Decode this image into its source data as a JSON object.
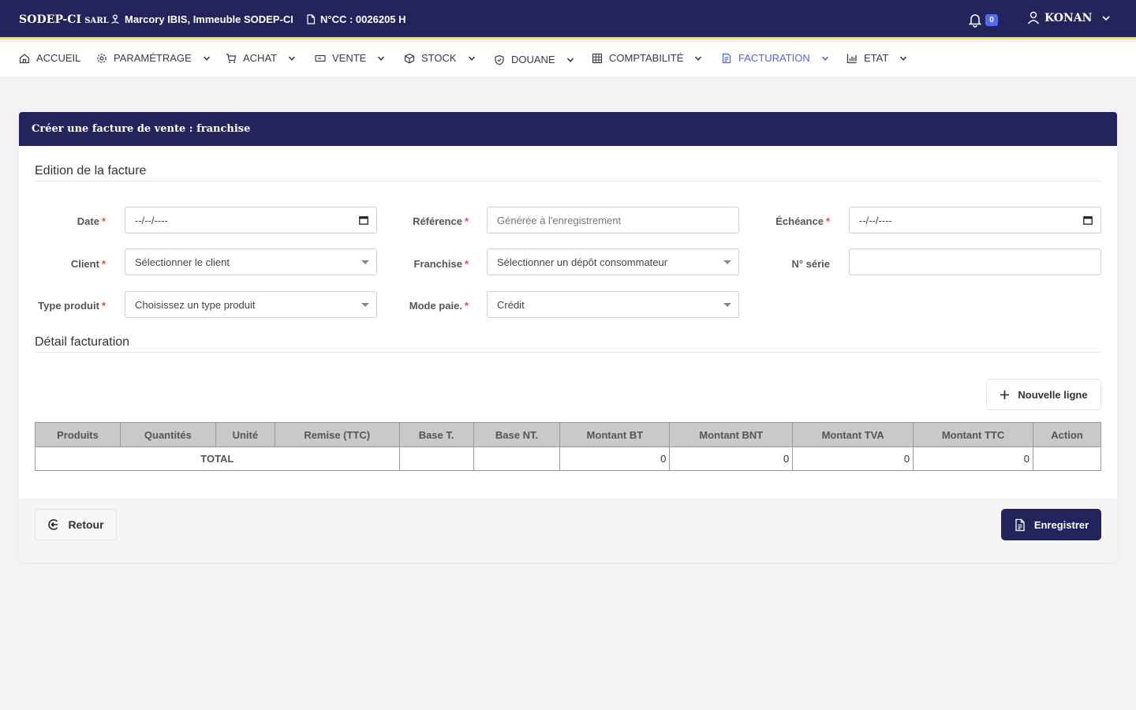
{
  "topbar": {
    "brand": "SODEP-CI",
    "brand_suffix": "SARL",
    "address": "Marcory IBIS, Immeuble SODEP-CI",
    "ncc": "N°CC : 0026205 H",
    "notification_count": "0",
    "user_name": "KONAN"
  },
  "nav": {
    "items": [
      {
        "label": "ACCUEIL",
        "icon": "home-icon"
      },
      {
        "label": "PARAMÉTRAGE",
        "icon": "gear-icon"
      },
      {
        "label": "ACHAT",
        "icon": "cart-icon"
      },
      {
        "label": "VENTE",
        "icon": "ticket-icon"
      },
      {
        "label": "STOCK",
        "icon": "box-icon"
      },
      {
        "label": "DOUANE",
        "icon": "shield-icon"
      },
      {
        "label": "COMPTABILITÉ",
        "icon": "grid-icon"
      },
      {
        "label": "FACTURATION",
        "icon": "invoice-icon",
        "active": true
      },
      {
        "label": "ETAT",
        "icon": "bar-chart-icon"
      }
    ]
  },
  "card": {
    "title": "Créer une facture de vente : franchise",
    "section_edition": "Edition de la facture",
    "section_detail": "Détail facturation"
  },
  "form": {
    "date": {
      "label": "Date",
      "value": "--/--/----"
    },
    "reference": {
      "label": "Référence",
      "placeholder": "Générée à l'enregistrement"
    },
    "echeance": {
      "label": "Échéance",
      "value": "--/--/----"
    },
    "client": {
      "label": "Client",
      "value": "Sélectionner le client"
    },
    "franchise": {
      "label": "Franchise",
      "value": "Sélectionner un dépôt consommateur"
    },
    "serie": {
      "label": "N° série",
      "value": ""
    },
    "type_produit": {
      "label": "Type produit",
      "value": "Choisissez un type produit"
    },
    "mode_paie": {
      "label": "Mode paie.",
      "value": "Crédit"
    },
    "required_mark": "*"
  },
  "buttons": {
    "new_line": "Nouvelle ligne",
    "back": "Retour",
    "save": "Enregistrer"
  },
  "table": {
    "columns": [
      "Produits",
      "Quantités",
      "Unité",
      "Remise (TTC)",
      "Base T.",
      "Base NT.",
      "Montant BT",
      "Montant BNT",
      "Montant TVA",
      "Montant TTC",
      "Action"
    ],
    "total_label": "TOTAL",
    "totals": {
      "base_t": "",
      "base_nt": "",
      "montant_bt": "0",
      "montant_bnt": "0",
      "montant_tva": "0",
      "montant_ttc": "0",
      "action": ""
    }
  },
  "colors": {
    "primary": "#24245c",
    "accent_line": "#e8e84a",
    "active_nav": "#4f63f0",
    "required": "#e74a3b"
  }
}
